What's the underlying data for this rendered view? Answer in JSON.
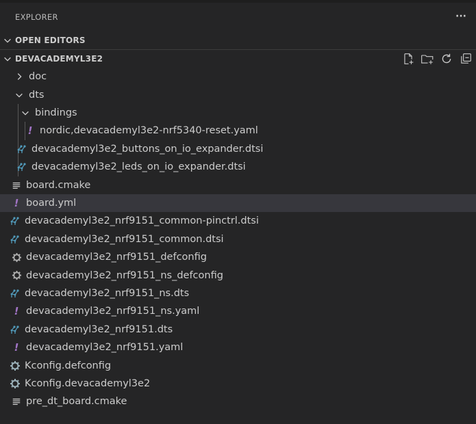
{
  "explorer": {
    "title": "EXPLORER",
    "more_icon": "ellipsis-icon"
  },
  "open_editors": {
    "label": "OPEN EDITORS",
    "expanded": false
  },
  "workspace": {
    "label": "DEVACADEMYL3E2",
    "actions": [
      "new-file-icon",
      "new-folder-icon",
      "refresh-icon",
      "collapse-all-icon"
    ]
  },
  "tree": [
    {
      "label": "doc",
      "type": "folder-collapsed",
      "icon": "chevron-right-icon"
    },
    {
      "label": "dts",
      "type": "folder-expanded",
      "icon": "chevron-down-icon"
    },
    {
      "label": "bindings",
      "type": "folder-expanded",
      "icon": "chevron-down-icon"
    },
    {
      "label": "nordic,devacademyl3e2-nrf5340-reset.yaml",
      "type": "yaml",
      "icon": "yaml-icon"
    },
    {
      "label": "devacademyl3e2_buttons_on_io_expander.dtsi",
      "type": "dts",
      "icon": "devicetree-icon"
    },
    {
      "label": "devacademyl3e2_leds_on_io_expander.dtsi",
      "type": "dts",
      "icon": "devicetree-icon"
    },
    {
      "label": "board.cmake",
      "type": "text",
      "icon": "lines-icon"
    },
    {
      "label": "board.yml",
      "type": "yaml",
      "icon": "yaml-icon",
      "selected": true
    },
    {
      "label": "devacademyl3e2_nrf9151_common-pinctrl.dtsi",
      "type": "dts",
      "icon": "devicetree-icon"
    },
    {
      "label": "devacademyl3e2_nrf9151_common.dtsi",
      "type": "dts",
      "icon": "devicetree-icon"
    },
    {
      "label": "devacademyl3e2_nrf9151_defconfig",
      "type": "config",
      "icon": "gear-icon"
    },
    {
      "label": "devacademyl3e2_nrf9151_ns_defconfig",
      "type": "config",
      "icon": "gear-icon"
    },
    {
      "label": "devacademyl3e2_nrf9151_ns.dts",
      "type": "dts",
      "icon": "devicetree-icon"
    },
    {
      "label": "devacademyl3e2_nrf9151_ns.yaml",
      "type": "yaml",
      "icon": "yaml-icon"
    },
    {
      "label": "devacademyl3e2_nrf9151.dts",
      "type": "dts",
      "icon": "devicetree-icon"
    },
    {
      "label": "devacademyl3e2_nrf9151.yaml",
      "type": "yaml",
      "icon": "yaml-icon"
    },
    {
      "label": "Kconfig.defconfig",
      "type": "kconfig",
      "icon": "kconfig-gear-icon"
    },
    {
      "label": "Kconfig.devacademyl3e2",
      "type": "kconfig",
      "icon": "kconfig-gear-icon"
    },
    {
      "label": "pre_dt_board.cmake",
      "type": "text",
      "icon": "lines-icon"
    }
  ],
  "colors": {
    "background": "#252526",
    "selected_row": "#37373d",
    "yaml_icon": "#a074c4",
    "devicetree_icon": "#519aba",
    "text": "#cccccc"
  }
}
